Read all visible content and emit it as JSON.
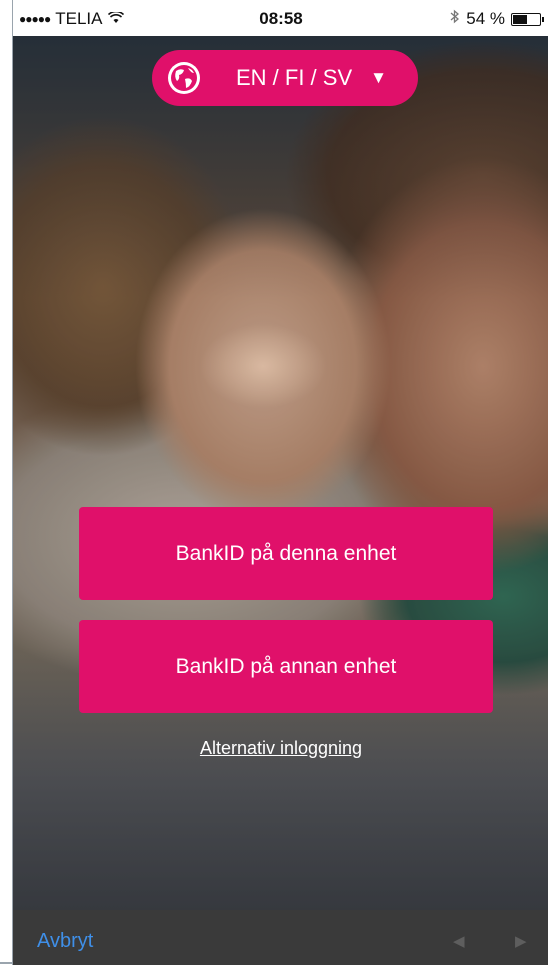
{
  "status_bar": {
    "signal_dots": "●●●●●",
    "carrier": "TELIA",
    "time": "08:58",
    "battery_percent": "54 %",
    "battery_level": 0.54
  },
  "language_selector": {
    "label": "EN / FI / SV",
    "icon": "globe-icon",
    "caret": "▼"
  },
  "buttons": {
    "bankid_this_device": "BankID på denna enhet",
    "bankid_other_device": "BankID på annan enhet"
  },
  "links": {
    "alternative_login": "Alternativ inloggning"
  },
  "toolbar": {
    "cancel": "Avbryt",
    "prev": "◀",
    "next": "▶"
  },
  "colors": {
    "accent": "#e0106a",
    "link_blue": "#3f8fe8"
  }
}
